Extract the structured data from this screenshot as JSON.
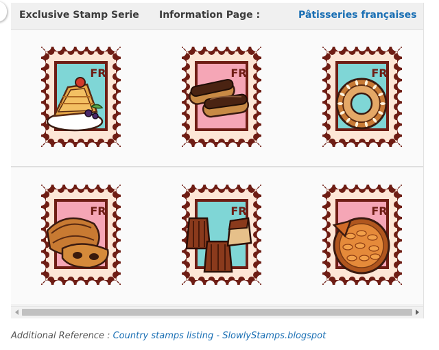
{
  "header": {
    "col1": "Exclusive Stamp Serie",
    "col2": "Information Page :",
    "col3": "Pâtisseries françaises"
  },
  "stamps": [
    {
      "name": "crepes-stamp",
      "country": "FR",
      "background": "#7fd6d6",
      "frame": "#6e1d14",
      "subject": "crepes"
    },
    {
      "name": "eclairs-stamp",
      "country": "FR",
      "background": "#f5a6b6",
      "frame": "#6e1d14",
      "subject": "eclairs"
    },
    {
      "name": "paris-brest-stamp",
      "country": "FR",
      "background": "#7fd6d6",
      "frame": "#6e1d14",
      "subject": "paris-brest"
    },
    {
      "name": "pain-au-chocolat-stamp",
      "country": "FR",
      "background": "#f5a6b6",
      "frame": "#6e1d14",
      "subject": "pain-au-chocolat"
    },
    {
      "name": "canneles-stamp",
      "country": "FR",
      "background": "#7fd6d6",
      "frame": "#6e1d14",
      "subject": "canneles"
    },
    {
      "name": "apricot-tart-stamp",
      "country": "FR",
      "background": "#f5a6b6",
      "frame": "#6e1d14",
      "subject": "apricot-tart"
    }
  ],
  "footer": {
    "prefix": "Additional Reference : ",
    "link_text": "Country stamps listing - SlowlyStamps.blogspot"
  },
  "colors": {
    "link": "#1a6fb4",
    "stamp_paper": "#fde6d6",
    "stamp_frame": "#6e1d14"
  }
}
